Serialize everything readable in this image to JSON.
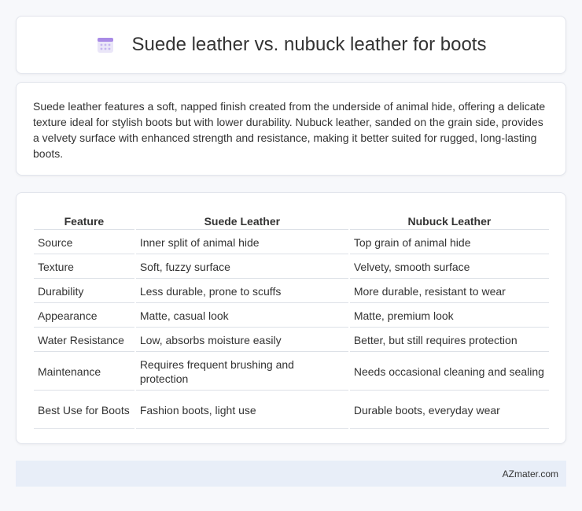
{
  "header": {
    "title": "Suede leather vs. nubuck leather for boots",
    "icon": "calendar-icon",
    "icon_colors": {
      "top": "#a98be6",
      "body": "#eae6f8",
      "dots": "#c4b5ef"
    }
  },
  "intro": {
    "text": "Suede leather features a soft, napped finish created from the underside of animal hide, offering a delicate texture ideal for stylish boots but with lower durability. Nubuck leather, sanded on the grain side, provides a velvety surface with enhanced strength and resistance, making it better suited for rugged, long-lasting boots."
  },
  "table": {
    "headers": [
      "Feature",
      "Suede Leather",
      "Nubuck Leather"
    ],
    "rows": [
      [
        "Source",
        "Inner split of animal hide",
        "Top grain of animal hide"
      ],
      [
        "Texture",
        "Soft, fuzzy surface",
        "Velvety, smooth surface"
      ],
      [
        "Durability",
        "Less durable, prone to scuffs",
        "More durable, resistant to wear"
      ],
      [
        "Appearance",
        "Matte, casual look",
        "Matte, premium look"
      ],
      [
        "Water Resistance",
        "Low, absorbs moisture easily",
        "Better, but still requires protection"
      ],
      [
        "Maintenance",
        "Requires frequent brushing and protection",
        "Needs occasional cleaning and sealing"
      ],
      [
        "Best Use for Boots",
        "Fashion boots, light use",
        "Durable boots, everyday wear"
      ]
    ]
  },
  "footer": {
    "site": "AZmater.com"
  }
}
